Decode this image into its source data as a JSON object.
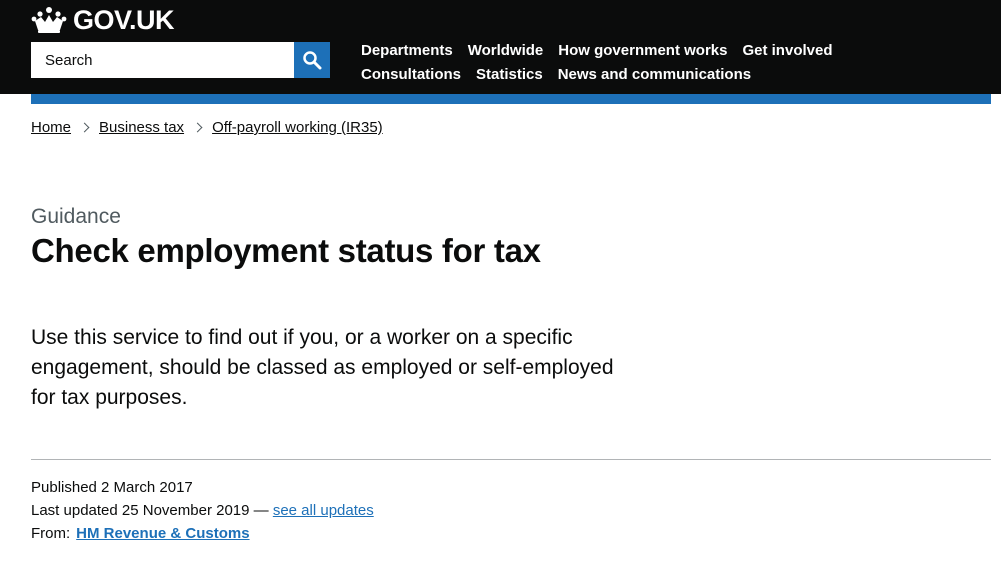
{
  "header": {
    "logo_text": "GOV.UK",
    "search": {
      "placeholder": "Search"
    },
    "nav": {
      "row1": [
        "Departments",
        "Worldwide",
        "How government works",
        "Get involved"
      ],
      "row2": [
        "Consultations",
        "Statistics",
        "News and communications"
      ]
    }
  },
  "breadcrumbs": [
    "Home",
    "Business tax",
    "Off-payroll working (IR35)"
  ],
  "page": {
    "caption": "Guidance",
    "title": "Check employment status for tax",
    "lead": "Use this service to find out if you, or a worker on a specific engagement, should be classed as employed or self-employed for tax purposes."
  },
  "metadata": {
    "published": "Published 2 March 2017",
    "last_updated": "Last updated 25 November 2019 —",
    "see_all_updates": "see all updates",
    "from_label": "From:",
    "from_org": "HM Revenue & Customs"
  },
  "colors": {
    "header_bg": "#0b0c0c",
    "brand_blue": "#1d70b8",
    "secondary_text": "#505a5f",
    "border": "#b1b4b6"
  },
  "icons": [
    "crown-icon",
    "search-icon",
    "chevron-right-icon"
  ]
}
